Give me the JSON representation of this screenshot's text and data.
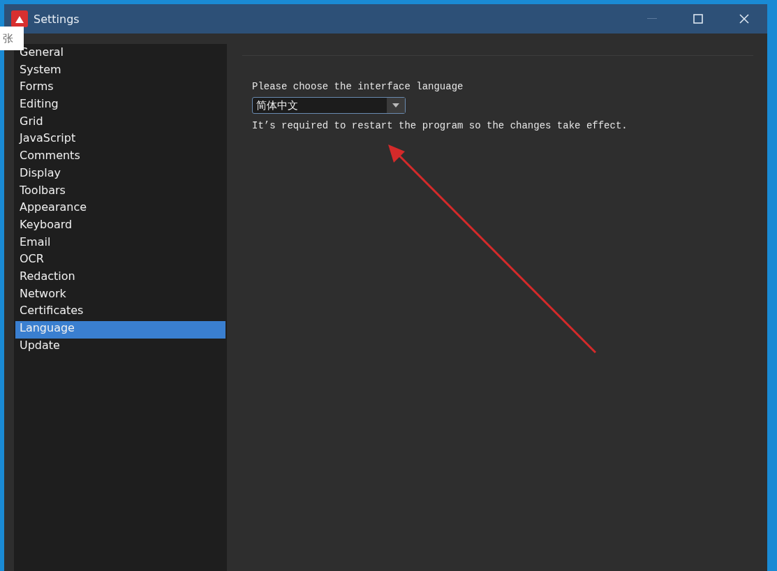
{
  "window": {
    "title": "Settings"
  },
  "ime_overlay": "张",
  "sidebar": {
    "items": [
      {
        "label": "General",
        "selected": false
      },
      {
        "label": "System",
        "selected": false
      },
      {
        "label": "Forms",
        "selected": false
      },
      {
        "label": "Editing",
        "selected": false
      },
      {
        "label": "Grid",
        "selected": false
      },
      {
        "label": "JavaScript",
        "selected": false
      },
      {
        "label": "Comments",
        "selected": false
      },
      {
        "label": "Display",
        "selected": false
      },
      {
        "label": "Toolbars",
        "selected": false
      },
      {
        "label": "Appearance",
        "selected": false
      },
      {
        "label": "Keyboard",
        "selected": false
      },
      {
        "label": "Email",
        "selected": false
      },
      {
        "label": "OCR",
        "selected": false
      },
      {
        "label": "Redaction",
        "selected": false
      },
      {
        "label": "Network",
        "selected": false
      },
      {
        "label": "Certificates",
        "selected": false
      },
      {
        "label": "Language",
        "selected": true
      },
      {
        "label": "Update",
        "selected": false
      }
    ]
  },
  "language": {
    "prompt": "Please choose the interface language",
    "value": "简体中文",
    "note": "It’s required to restart the program so the changes take effect."
  }
}
